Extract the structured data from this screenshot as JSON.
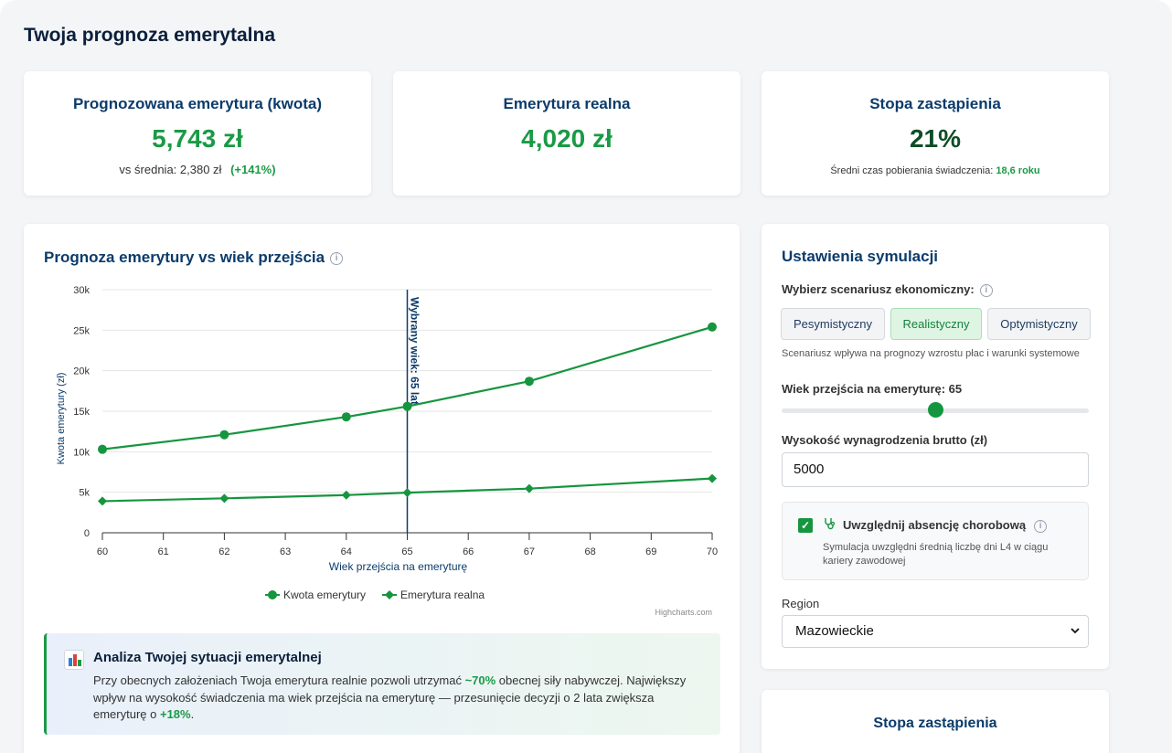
{
  "page": {
    "title": "Twoja prognoza emerytalna"
  },
  "stats": {
    "projected": {
      "label": "Prognozowana emerytura (kwota)",
      "value": "5,743 zł",
      "sub_prefix": "vs średnia: 2,380 zł",
      "delta": "(+141%)"
    },
    "real": {
      "label": "Emerytura realna",
      "value": "4,020 zł"
    },
    "replacement": {
      "label": "Stopa zastąpienia",
      "value": "21%",
      "sub_prefix": "Średni czas pobierania świadczenia:",
      "sub_value": "18,6 roku"
    }
  },
  "chart_section": {
    "title": "Prognoza emerytury vs wiek przejścia",
    "credits": "Highcharts.com"
  },
  "chart_data": {
    "type": "line",
    "title": "Prognoza emerytury vs wiek przejścia",
    "xlabel": "Wiek przejścia na emeryturę",
    "ylabel": "Kwota emerytury (zł)",
    "x_ticks": [
      "60",
      "61",
      "62",
      "63",
      "64",
      "65",
      "66",
      "67",
      "68",
      "69",
      "70"
    ],
    "y_ticks": [
      "0",
      "5k",
      "10k",
      "15k",
      "20k",
      "25k",
      "30k"
    ],
    "xlim": [
      60,
      70
    ],
    "ylim": [
      0,
      30000
    ],
    "grid": true,
    "legend": "bottom",
    "plot_line": {
      "x": 65,
      "label": "Wybrany wiek: 65 lat"
    },
    "series": [
      {
        "name": "Kwota emerytury",
        "marker": "circle",
        "color": "#16953f",
        "x": [
          60,
          62,
          64,
          65,
          67,
          70
        ],
        "values": [
          10300,
          12100,
          14300,
          15600,
          18700,
          25400
        ]
      },
      {
        "name": "Emerytura realna",
        "marker": "diamond",
        "color": "#16953f",
        "x": [
          60,
          62,
          64,
          65,
          67,
          70
        ],
        "values": [
          3900,
          4250,
          4650,
          4950,
          5450,
          6700
        ]
      }
    ]
  },
  "analysis": {
    "title": "Analiza Twojej sytuacji emerytalnej",
    "text_1": "Przy obecnych założeniach Twoja emerytura realnie pozwoli utrzymać ",
    "highlight_1": "~70%",
    "text_2": " obecnej siły nabywczej. Największy wpływ na wysokość świadczenia ma wiek przejścia na emeryturę — przesunięcie decyzji o 2 lata zwiększa emeryturę o ",
    "highlight_2": "+18%",
    "text_3": "."
  },
  "settings": {
    "title": "Ustawienia symulacji",
    "scenario_label": "Wybierz scenariusz ekonomiczny:",
    "scenarios": [
      "Pesymistyczny",
      "Realistyczny",
      "Optymistyczny"
    ],
    "selected_scenario": "Realistyczny",
    "scenario_hint": "Scenariusz wpływa na prognozy wzrostu płac i warunki systemowe",
    "age_label": "Wiek przejścia na emeryturę: 65",
    "age_value": 65,
    "age_range": [
      60,
      70
    ],
    "salary_label": "Wysokość wynagrodzenia brutto (zł)",
    "salary_value": "5000",
    "absence_label": "Uwzględnij absencję chorobową",
    "absence_checked": true,
    "absence_desc": "Symulacja uwzględni średnią liczbę dni L4 w ciągu kariery zawodowej",
    "region_label": "Region",
    "region_value": "Mazowieckie"
  },
  "stopa_card": {
    "title": "Stopa zastąpienia"
  }
}
